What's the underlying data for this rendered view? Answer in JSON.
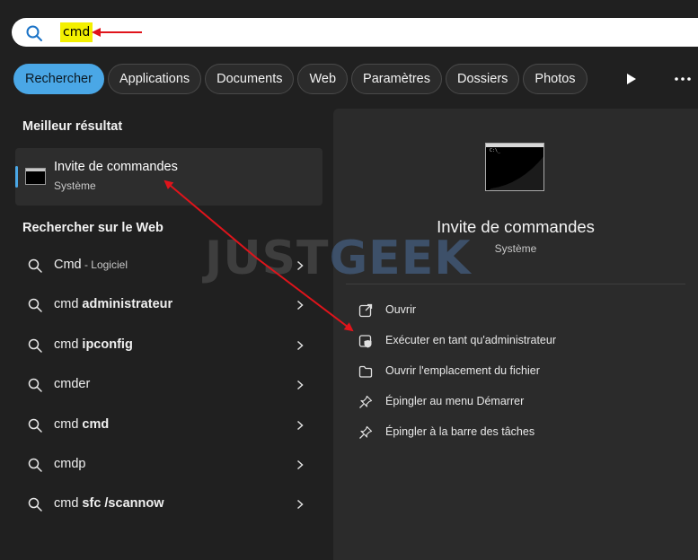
{
  "search": {
    "query": "cmd"
  },
  "filters": [
    {
      "label": "Rechercher",
      "active": true
    },
    {
      "label": "Applications"
    },
    {
      "label": "Documents"
    },
    {
      "label": "Web"
    },
    {
      "label": "Paramètres"
    },
    {
      "label": "Dossiers"
    },
    {
      "label": "Photos"
    }
  ],
  "best_match": {
    "heading": "Meilleur résultat",
    "title": "Invite de commandes",
    "subtitle": "Système"
  },
  "web_search": {
    "heading": "Rechercher sur le Web",
    "items": [
      {
        "prefix": "Cmd",
        "bold": "",
        "suffix": " - Logiciel"
      },
      {
        "prefix": "cmd ",
        "bold": "administrateur",
        "suffix": ""
      },
      {
        "prefix": "cmd ",
        "bold": "ipconfig",
        "suffix": ""
      },
      {
        "prefix": "cmder",
        "bold": "",
        "suffix": ""
      },
      {
        "prefix": "cmd ",
        "bold": "cmd",
        "suffix": ""
      },
      {
        "prefix": "cmdp",
        "bold": "",
        "suffix": ""
      },
      {
        "prefix": "cmd ",
        "bold": "sfc /scannow",
        "suffix": ""
      }
    ]
  },
  "detail": {
    "title": "Invite de commandes",
    "subtitle": "Système",
    "actions": [
      {
        "icon": "open-external-icon",
        "label": "Ouvrir"
      },
      {
        "icon": "admin-shield-icon",
        "label": "Exécuter en tant qu'administrateur"
      },
      {
        "icon": "folder-icon",
        "label": "Ouvrir l'emplacement du fichier"
      },
      {
        "icon": "pin-icon",
        "label": "Épingler au menu Démarrer"
      },
      {
        "icon": "pin-icon",
        "label": "Épingler à la barre des tâches"
      }
    ]
  },
  "watermark": {
    "part1": "JUST",
    "part2": "GEEK"
  },
  "colors": {
    "accent": "#4aa7e6",
    "highlight": "#f4f000",
    "arrow": "#e0141b"
  }
}
